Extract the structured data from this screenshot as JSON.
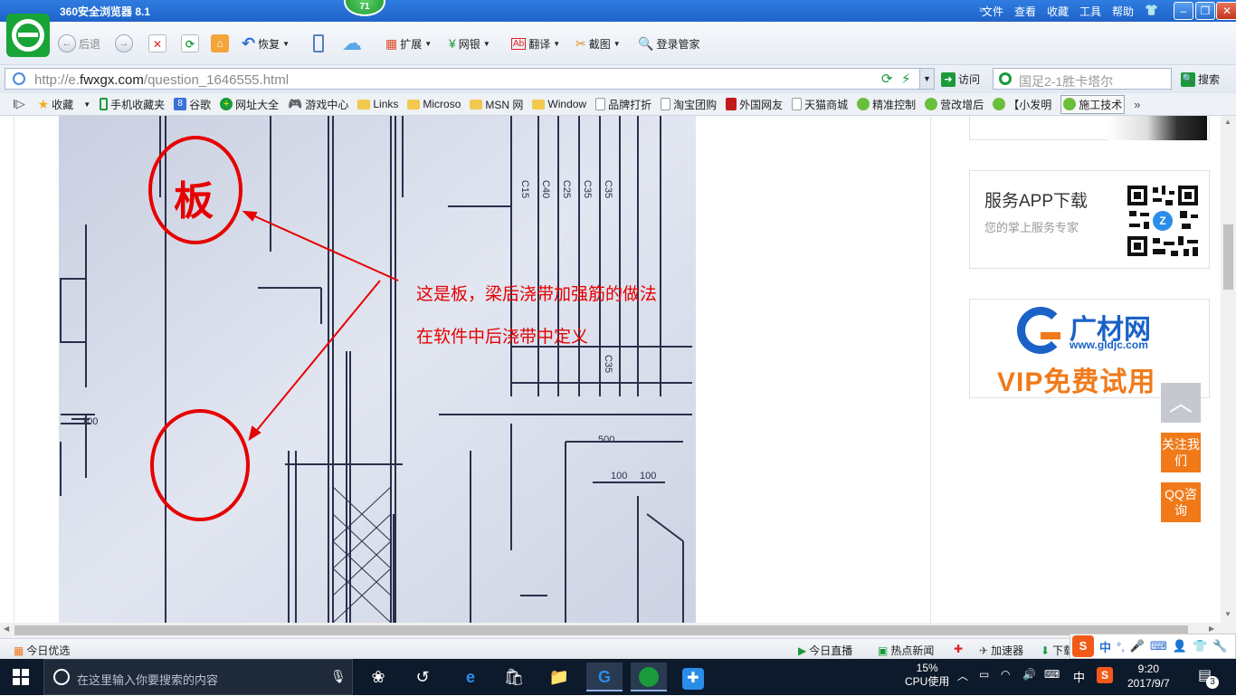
{
  "window": {
    "title": "360安全浏览器 8.1",
    "badge": "71",
    "menu": [
      "文件",
      "查看",
      "收藏",
      "工具",
      "帮助"
    ],
    "controls": {
      "minimize": "–",
      "restore": "❐",
      "close": "✕"
    }
  },
  "toolbar": {
    "back": "后退",
    "restore": "恢复",
    "extend": "扩展",
    "bank": "网银",
    "translate": "翻译",
    "screenshot": "截图",
    "login_manager": "登录管家"
  },
  "address": {
    "url_prefix": "http://e.",
    "url_domain": "fwxgx.com",
    "url_path": "/question_1646555.html",
    "go": "访问",
    "search_placeholder": "国足2-1胜卡塔尔",
    "search_button": "搜索"
  },
  "favorites": {
    "collect": "收藏",
    "items": [
      "手机收藏夹",
      "谷歌",
      "网址大全",
      "游戏中心",
      "Links",
      "Microso",
      "MSN 网",
      "Window",
      "品牌打折",
      "淘宝团购",
      "外国网友",
      "天猫商城",
      "精准控制",
      "营改增后",
      "【小发明",
      "施工技术"
    ]
  },
  "content": {
    "photo_label_ban": "板",
    "annotation_1": "这是板，梁后浇带加强筋的做法",
    "annotation_2": "在软件中后浇带中定义",
    "drawing_labels": {
      "l100": "100",
      "m500": "500",
      "m100a": "100",
      "m100b": "100",
      "c15": "C15",
      "c40": "C40",
      "c25": "C25",
      "c35a": "C35",
      "c35b": "C35",
      "c35c": "C35"
    }
  },
  "sidebar": {
    "app_title": "服务APP下载",
    "app_subtitle": "您的掌上服务专家",
    "ad_brand": "广材网",
    "ad_site": "www.gldjc.com",
    "ad_vip": "VIP免费试用",
    "back_to_top": "︿",
    "follow": "关注我们",
    "qq": "QQ咨询"
  },
  "statusbar": {
    "today": "今日优选",
    "live": "今日直播",
    "hot_news": "热点新闻",
    "accelerator": "加速器",
    "download": "下载"
  },
  "taskbar": {
    "search_placeholder": "在这里输入你要搜索的内容",
    "cpu_percent": "15%",
    "cpu_label": "CPU使用",
    "ime": "中",
    "time": "9:20",
    "date": "2017/9/7",
    "notifications": "3"
  },
  "colors": {
    "titlebar": "#2f7ce0",
    "annotation_red": "#e60000",
    "accent_orange": "#f07a1a",
    "taskbar": "#0d1a2b"
  }
}
